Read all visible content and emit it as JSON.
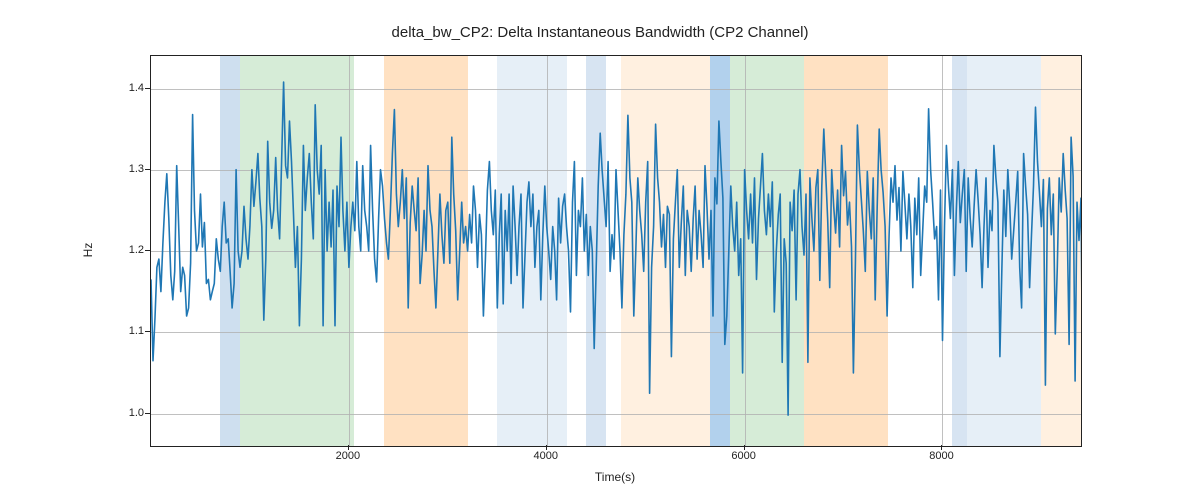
{
  "chart_data": {
    "type": "line",
    "title": "delta_bw_CP2: Delta Instantaneous Bandwidth (CP2 Channel)",
    "xlabel": "Time(s)",
    "ylabel": "Hz",
    "xlim": [
      0,
      9400
    ],
    "ylim": [
      0.96,
      1.44
    ],
    "xticks": [
      2000,
      4000,
      6000,
      8000
    ],
    "yticks": [
      1.0,
      1.1,
      1.2,
      1.3,
      1.4
    ],
    "spans": [
      {
        "x0": 700,
        "x1": 900,
        "color": "#c6d9ec",
        "alpha": 0.85
      },
      {
        "x0": 900,
        "x1": 2050,
        "color": "#c8e6c9",
        "alpha": 0.75
      },
      {
        "x0": 2350,
        "x1": 3200,
        "color": "#ffd9b3",
        "alpha": 0.8
      },
      {
        "x0": 3500,
        "x1": 4200,
        "color": "#dce8f4",
        "alpha": 0.7
      },
      {
        "x0": 4400,
        "x1": 4600,
        "color": "#c6d9ec",
        "alpha": 0.7
      },
      {
        "x0": 4750,
        "x1": 5650,
        "color": "#ffe6cc",
        "alpha": 0.6
      },
      {
        "x0": 5650,
        "x1": 5850,
        "color": "#9fc5e8",
        "alpha": 0.8
      },
      {
        "x0": 5850,
        "x1": 6600,
        "color": "#c8e6c9",
        "alpha": 0.75
      },
      {
        "x0": 6600,
        "x1": 7450,
        "color": "#ffd9b3",
        "alpha": 0.8
      },
      {
        "x0": 8100,
        "x1": 8250,
        "color": "#c6d9ec",
        "alpha": 0.7
      },
      {
        "x0": 8250,
        "x1": 9000,
        "color": "#dce8f4",
        "alpha": 0.7
      },
      {
        "x0": 9000,
        "x1": 9400,
        "color": "#ffe6cc",
        "alpha": 0.6
      }
    ],
    "series": [
      {
        "name": "delta_bw_CP2",
        "color": "#1f77b4",
        "x_step": 20,
        "y": [
          1.165,
          1.065,
          1.118,
          1.18,
          1.19,
          1.15,
          1.21,
          1.26,
          1.295,
          1.24,
          1.17,
          1.14,
          1.175,
          1.305,
          1.23,
          1.15,
          1.18,
          1.17,
          1.12,
          1.13,
          1.185,
          1.368,
          1.25,
          1.2,
          1.21,
          1.27,
          1.205,
          1.235,
          1.16,
          1.165,
          1.14,
          1.15,
          1.16,
          1.215,
          1.19,
          1.175,
          1.23,
          1.26,
          1.21,
          1.215,
          1.175,
          1.13,
          1.16,
          1.3,
          1.2,
          1.18,
          1.2,
          1.255,
          1.215,
          1.19,
          1.23,
          1.3,
          1.255,
          1.285,
          1.32,
          1.265,
          1.23,
          1.115,
          1.19,
          1.335,
          1.26,
          1.228,
          1.25,
          1.315,
          1.25,
          1.215,
          1.31,
          1.408,
          1.305,
          1.29,
          1.36,
          1.31,
          1.245,
          1.18,
          1.23,
          1.108,
          1.19,
          1.33,
          1.25,
          1.29,
          1.32,
          1.26,
          1.215,
          1.38,
          1.3,
          1.27,
          1.33,
          1.108,
          1.3,
          1.2,
          1.26,
          1.205,
          1.275,
          1.108,
          1.28,
          1.23,
          1.34,
          1.25,
          1.2,
          1.26,
          1.18,
          1.23,
          1.26,
          1.225,
          1.31,
          1.23,
          1.2,
          1.305,
          1.25,
          1.23,
          1.2,
          1.33,
          1.25,
          1.19,
          1.162,
          1.24,
          1.3,
          1.28,
          1.24,
          1.21,
          1.19,
          1.25,
          1.32,
          1.374,
          1.27,
          1.23,
          1.26,
          1.3,
          1.24,
          1.29,
          1.13,
          1.235,
          1.28,
          1.25,
          1.225,
          1.29,
          1.16,
          1.195,
          1.25,
          1.2,
          1.305,
          1.25,
          1.23,
          1.175,
          1.13,
          1.2,
          1.27,
          1.22,
          1.185,
          1.25,
          1.26,
          1.185,
          1.34,
          1.27,
          1.225,
          1.14,
          1.2,
          1.26,
          1.21,
          1.23,
          1.2,
          1.245,
          1.21,
          1.28,
          1.25,
          1.18,
          1.245,
          1.22,
          1.12,
          1.19,
          1.275,
          1.31,
          1.25,
          1.22,
          1.275,
          1.13,
          1.22,
          1.27,
          1.135,
          1.25,
          1.2,
          1.27,
          1.16,
          1.28,
          1.23,
          1.17,
          1.23,
          1.27,
          1.13,
          1.195,
          1.26,
          1.285,
          1.23,
          1.27,
          1.18,
          1.23,
          1.25,
          1.14,
          1.22,
          1.28,
          1.23,
          1.2,
          1.165,
          1.23,
          1.2,
          1.14,
          1.265,
          1.21,
          1.255,
          1.27,
          1.23,
          1.2,
          1.125,
          1.26,
          1.31,
          1.17,
          1.25,
          1.23,
          1.29,
          1.2,
          1.245,
          1.17,
          1.23,
          1.2,
          1.08,
          1.18,
          1.28,
          1.345,
          1.3,
          1.265,
          1.23,
          1.31,
          1.175,
          1.22,
          1.19,
          1.3,
          1.25,
          1.2,
          1.13,
          1.22,
          1.27,
          1.367,
          1.29,
          1.26,
          1.12,
          1.2,
          1.29,
          1.25,
          1.22,
          1.175,
          1.26,
          1.31,
          1.025,
          1.18,
          1.23,
          1.356,
          1.29,
          1.26,
          1.205,
          1.245,
          1.18,
          1.255,
          1.245,
          1.07,
          1.215,
          1.26,
          1.3,
          1.18,
          1.235,
          1.28,
          1.17,
          1.25,
          1.23,
          1.175,
          1.24,
          1.28,
          1.19,
          1.25,
          1.22,
          1.18,
          1.305,
          1.253,
          1.19,
          1.25,
          1.12,
          1.29,
          1.258,
          1.36,
          1.31,
          1.265,
          1.085,
          1.12,
          1.2,
          1.28,
          1.23,
          1.2,
          1.26,
          1.17,
          1.215,
          1.05,
          1.3,
          1.25,
          1.215,
          1.27,
          1.21,
          1.29,
          1.165,
          1.24,
          1.278,
          1.32,
          1.25,
          1.22,
          1.27,
          1.23,
          1.285,
          1.125,
          1.2,
          1.245,
          1.27,
          1.063,
          1.215,
          1.185,
          0.998,
          1.26,
          1.225,
          1.275,
          1.14,
          1.27,
          1.3,
          1.23,
          1.195,
          1.27,
          1.063,
          1.29,
          1.24,
          1.2,
          1.278,
          1.3,
          1.164,
          1.28,
          1.35,
          1.295,
          1.238,
          1.155,
          1.3,
          1.255,
          1.222,
          1.275,
          1.205,
          1.33,
          1.268,
          1.298,
          1.232,
          1.26,
          1.205,
          1.05,
          1.185,
          1.355,
          1.3,
          1.262,
          1.225,
          1.175,
          1.298,
          1.25,
          1.215,
          1.29,
          1.14,
          1.255,
          1.35,
          1.3,
          1.272,
          1.23,
          1.12,
          1.22,
          1.29,
          1.26,
          1.305,
          1.238,
          1.278,
          1.2,
          1.298,
          1.258,
          1.215,
          1.27,
          1.23,
          1.155,
          1.265,
          1.22,
          1.29,
          1.17,
          1.225,
          1.28,
          1.26,
          1.375,
          1.3,
          1.26,
          1.215,
          1.23,
          1.14,
          1.275,
          1.09,
          1.23,
          1.33,
          1.28,
          1.24,
          1.3,
          1.17,
          1.25,
          1.31,
          1.235,
          1.27,
          1.3,
          1.175,
          1.29,
          1.24,
          1.205,
          1.255,
          1.3,
          1.263,
          1.22,
          1.155,
          1.23,
          1.29,
          1.18,
          1.25,
          1.225,
          1.33,
          1.29,
          1.26,
          1.07,
          1.18,
          1.275,
          1.218,
          1.3,
          1.255,
          1.19,
          1.225,
          1.26,
          1.298,
          1.18,
          1.13,
          1.32,
          1.28,
          1.245,
          1.155,
          1.22,
          1.28,
          1.377,
          1.31,
          1.273,
          1.23,
          1.288,
          1.035,
          1.252,
          1.29,
          1.22,
          1.27,
          1.098,
          1.18,
          1.29,
          1.248,
          1.32,
          1.275,
          1.24,
          1.085,
          1.34,
          1.292,
          1.04,
          1.26,
          1.213,
          1.265,
          0.98,
          1.19,
          1.255,
          1.215,
          1.27,
          1.235,
          1.3,
          1.14,
          1.195
        ]
      }
    ]
  }
}
